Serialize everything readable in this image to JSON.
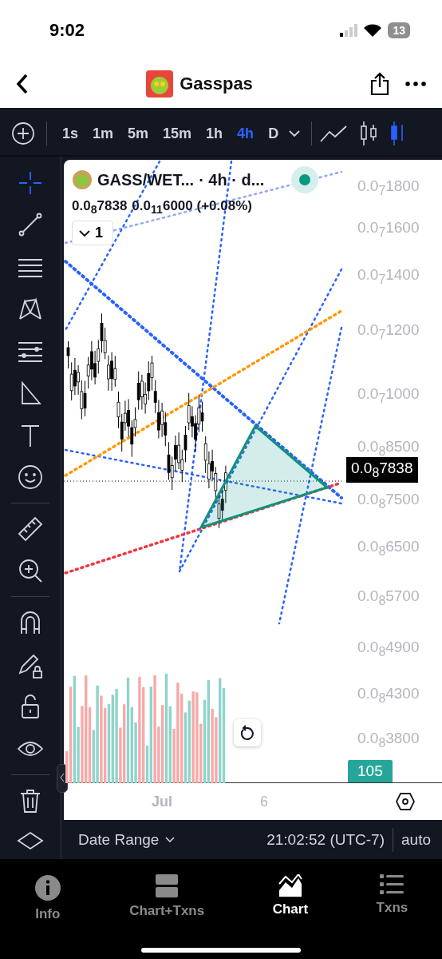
{
  "status_bar": {
    "time": "9:02",
    "battery": "13"
  },
  "header": {
    "title": "Gasspas"
  },
  "intervals": [
    {
      "label": "1s",
      "selected": false
    },
    {
      "label": "1m",
      "selected": false
    },
    {
      "label": "5m",
      "selected": false
    },
    {
      "label": "15m",
      "selected": false
    },
    {
      "label": "1h",
      "selected": false
    },
    {
      "label": "4h",
      "selected": true
    },
    {
      "label": "D",
      "selected": false
    }
  ],
  "tools": [
    {
      "kind": "crosshair",
      "selected": true
    },
    {
      "kind": "line",
      "selected": false
    },
    {
      "kind": "hlines",
      "selected": false
    },
    {
      "kind": "pattern",
      "selected": false
    },
    {
      "kind": "fib",
      "selected": false
    },
    {
      "kind": "triangle",
      "selected": false
    },
    {
      "kind": "text",
      "selected": false
    },
    {
      "kind": "emoji",
      "selected": false
    },
    {
      "kind": "ruler",
      "selected": false
    },
    {
      "kind": "zoom",
      "selected": false
    },
    {
      "kind": "magnet",
      "selected": false
    },
    {
      "kind": "pencil-lock",
      "selected": false
    },
    {
      "kind": "lock",
      "selected": false
    },
    {
      "kind": "eye",
      "selected": false
    },
    {
      "kind": "trash",
      "selected": false
    },
    {
      "kind": "layers",
      "selected": false
    }
  ],
  "legend": {
    "symbol": "GASS/WET...",
    "interval": "· 4h · d...",
    "price": "0.0$_{8}$7838",
    "change": "0.0$_{11}$6000 (+0.08%)",
    "indicators": "1"
  },
  "price_axis": [
    "0.0$_{7}$1800",
    "0.0$_{7}$1600",
    "0.0$_{7}$1400",
    "0.0$_{7}$1200",
    "0.0$_{7}$1000",
    "0.0$_{8}$8500",
    "0.0$_{8}$7500",
    "0.0$_{8}$6500",
    "0.0$_{8}$5700",
    "0.0$_{8}$4900",
    "0.0$_{8}$4300",
    "0.0$_{8}$3800"
  ],
  "last_price": "0.0$_{8}$7838",
  "volume_tag": "105",
  "time_axis": [
    "Jul",
    "6"
  ],
  "footer": {
    "range": "Date Range",
    "clock": "21:02:52 (UTC-7)",
    "scale": "auto"
  },
  "tabs": [
    {
      "label": "Info",
      "kind": "info",
      "selected": false
    },
    {
      "label": "Chart+Txns",
      "kind": "split",
      "selected": false
    },
    {
      "label": "Chart",
      "kind": "chart",
      "selected": true
    },
    {
      "label": "Txns",
      "kind": "list",
      "selected": false
    }
  ]
}
